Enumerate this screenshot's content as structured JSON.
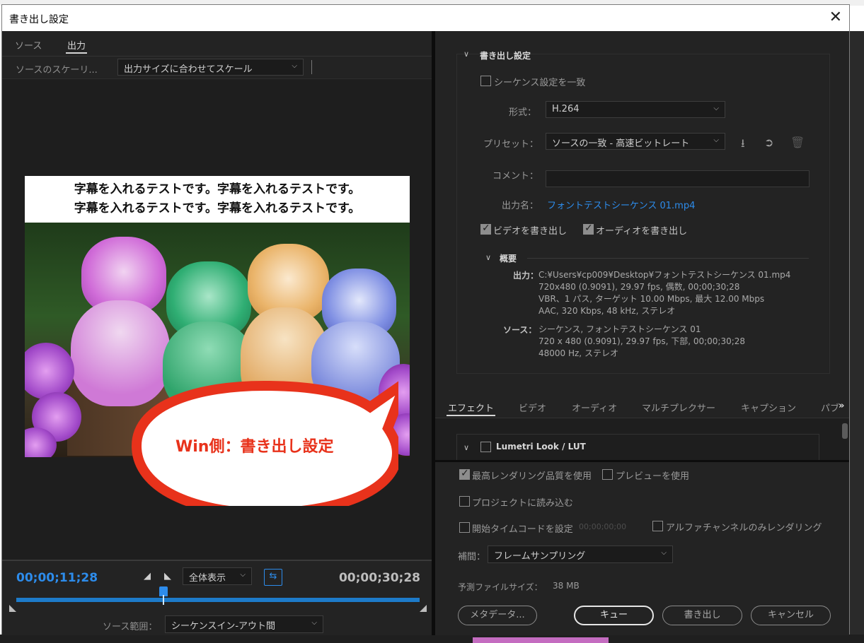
{
  "dialog": {
    "title": "書き出し設定",
    "close_label": "✕"
  },
  "left": {
    "tabs": [
      {
        "label": "ソース"
      },
      {
        "label": "出力"
      }
    ],
    "scale_label": "ソースのスケーリ...",
    "scale_value": "出力サイズに合わせてスケール",
    "preview": {
      "subtitle_line1": "字幕を入れるテストです。字幕を入れるテストです。",
      "subtitle_line2": "字幕を入れるテストです。字幕を入れるテストです。",
      "callout": "Win側：書き出し設定"
    },
    "timeline": {
      "current_timecode": "00;00;11;28",
      "duration_timecode": "00;00;30;28",
      "zoom_value": "全体表示",
      "source_range_label": "ソース範囲：",
      "source_range_value": "シーケンスイン-アウト間"
    }
  },
  "export": {
    "section_title": "書き出し設定",
    "match_sequence_label": "シーケンス設定を一致",
    "format_label": "形式：",
    "format_value": "H.264",
    "preset_label": "プリセット：",
    "preset_value": "ソースの一致 - 高速ビットレート",
    "comment_label": "コメント：",
    "output_name_label": "出力名：",
    "output_name_value": "フォントテストシーケンス 01.mp4",
    "export_video_label": "ビデオを書き出し",
    "export_audio_label": "オーディオを書き出し",
    "summary_title": "概要",
    "output_key": "出力：",
    "output_lines": [
      "C:¥Users¥cp009¥Desktop¥フォントテストシーケンス 01.mp4",
      "720x480 (0.9091), 29.97 fps, 偶数, 00;00;30;28",
      "VBR、1 パス, ターゲット 10.00 Mbps, 最大 12.00 Mbps",
      "AAC, 320 Kbps, 48 kHz, ステレオ"
    ],
    "source_key": "ソース：",
    "source_lines": [
      "シーケンス, フォントテストシーケンス 01",
      "720 x 480 (0.9091), 29.97 fps, 下部, 00;00;30;28",
      "48000 Hz, ステレオ"
    ]
  },
  "effect_tabs": [
    {
      "label": "エフェクト"
    },
    {
      "label": "ビデオ"
    },
    {
      "label": "オーディオ"
    },
    {
      "label": "マルチプレクサー"
    },
    {
      "label": "キャプション"
    },
    {
      "label": "パブ"
    }
  ],
  "effect_more": "»",
  "lumetri_label": "Lumetri Look / LUT",
  "options": {
    "max_render_quality": "最高レンダリング品質を使用",
    "use_previews": "プレビューを使用",
    "import_project": "プロジェクトに読み込む",
    "set_start_timecode": "開始タイムコードを設定",
    "start_timecode_value": "00;00;00;00",
    "alpha_only": "アルファチャンネルのみレンダリング",
    "interp_label": "補間：",
    "interp_value": "フレームサンプリング",
    "est_size_label": "予測ファイルサイズ：",
    "est_size_value": "38 MB"
  },
  "buttons": {
    "metadata": "メタデータ...",
    "queue": "キュー",
    "export": "書き出し",
    "cancel": "キャンセル"
  },
  "colors": {
    "accent": "#2d8ceb",
    "callout_red": "#e8321b",
    "panel": "#232323"
  }
}
